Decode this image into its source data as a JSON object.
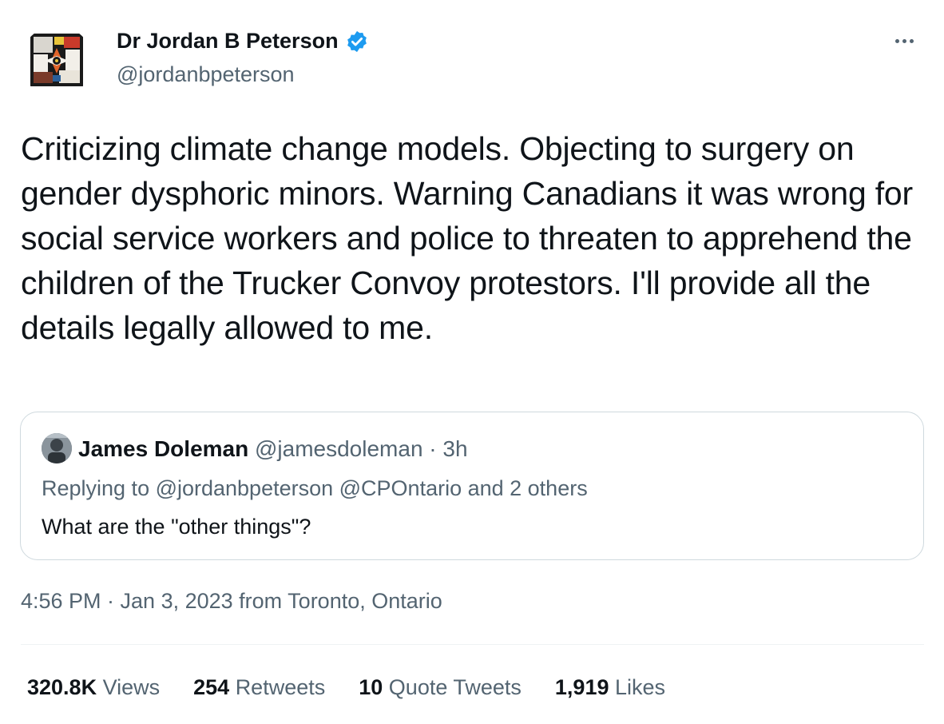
{
  "author": {
    "name": "Dr Jordan B Peterson",
    "handle": "@jordanbpeterson",
    "verified_color": "#1d9bf0"
  },
  "tweet": {
    "text": "Criticizing climate change models. Objecting to surgery on gender dysphoric minors. Warning Canadians it was wrong for social service workers and police to threaten to apprehend the children of the Trucker Convoy protestors. I'll provide all the details legally allowed to me.",
    "timestamp": "4:56 PM · Jan 3, 2023 from Toronto, Ontario"
  },
  "quote": {
    "name": "James Doleman",
    "handle_and_time": "@jamesdoleman · 3h",
    "replying_to": "Replying to @jordanbpeterson @CPOntario and 2 others",
    "text": "What are the \"other things\"?"
  },
  "stats": [
    {
      "value": "320.8K",
      "label": "Views"
    },
    {
      "value": "254",
      "label": "Retweets"
    },
    {
      "value": "10",
      "label": "Quote Tweets"
    },
    {
      "value": "1,919",
      "label": "Likes"
    }
  ],
  "icons": {
    "verified": "verified-badge-icon",
    "more": "more-options-icon"
  },
  "colors": {
    "text_primary": "#0f1419",
    "text_secondary": "#536471",
    "border": "#cfd9de",
    "accent": "#1d9bf0"
  }
}
